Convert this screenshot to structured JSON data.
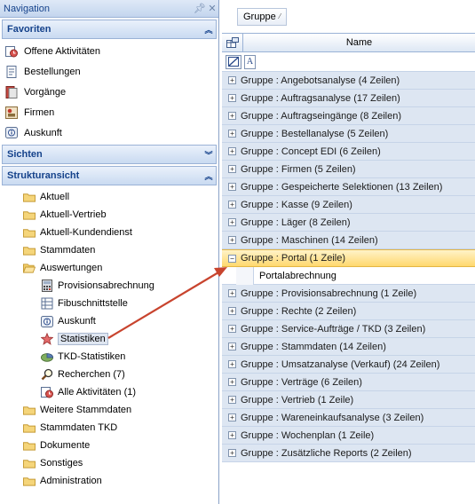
{
  "nav": {
    "title": "Navigation",
    "favorites": {
      "title": "Favoriten",
      "items": [
        {
          "label": "Offene Aktivitäten",
          "icon": "activities-icon"
        },
        {
          "label": "Bestellungen",
          "icon": "orders-icon"
        },
        {
          "label": "Vorgänge",
          "icon": "processes-icon"
        },
        {
          "label": "Firmen",
          "icon": "companies-icon"
        },
        {
          "label": "Auskunft",
          "icon": "info-icon"
        }
      ]
    },
    "views": {
      "title": "Sichten"
    },
    "structure": {
      "title": "Strukturansicht",
      "items": [
        {
          "label": "Aktuell",
          "icon": "folder-icon",
          "level": 1
        },
        {
          "label": "Aktuell-Vertrieb",
          "icon": "folder-icon",
          "level": 1
        },
        {
          "label": "Aktuell-Kundendienst",
          "icon": "folder-icon",
          "level": 1
        },
        {
          "label": "Stammdaten",
          "icon": "folder-icon",
          "level": 1
        },
        {
          "label": "Auswertungen",
          "icon": "folder-open-icon",
          "level": 1
        },
        {
          "label": "Provisionsabrechnung",
          "icon": "calculator-icon",
          "level": 2
        },
        {
          "label": "Fibuschnittstelle",
          "icon": "ledger-icon",
          "level": 2
        },
        {
          "label": "Auskunft",
          "icon": "info-icon",
          "level": 2
        },
        {
          "label": "Statistiken",
          "icon": "star-icon",
          "level": 2,
          "selected": true
        },
        {
          "label": "TKD-Statistiken",
          "icon": "chart-disc-icon",
          "level": 2
        },
        {
          "label": "Recherchen (7)",
          "icon": "magnifier-icon",
          "level": 2
        },
        {
          "label": "Alle Aktivitäten (1)",
          "icon": "activities-icon",
          "level": 2
        },
        {
          "label": "Weitere Stammdaten",
          "icon": "folder-icon",
          "level": 1
        },
        {
          "label": "Stammdaten TKD",
          "icon": "folder-icon",
          "level": 1
        },
        {
          "label": "Dokumente",
          "icon": "folder-icon",
          "level": 1
        },
        {
          "label": "Sonstiges",
          "icon": "folder-icon",
          "level": 1
        },
        {
          "label": "Administration",
          "icon": "folder-icon",
          "level": 1
        }
      ]
    }
  },
  "grid": {
    "group_chip": "Gruppe",
    "column_name": "Name",
    "filter_a": "A",
    "groups": [
      {
        "label": "Gruppe : Angebotsanalyse (4 Zeilen)"
      },
      {
        "label": "Gruppe : Auftragsanalyse (17 Zeilen)"
      },
      {
        "label": "Gruppe : Auftragseingänge (8 Zeilen)"
      },
      {
        "label": "Gruppe : Bestellanalyse (5 Zeilen)"
      },
      {
        "label": "Gruppe : Concept EDI (6 Zeilen)"
      },
      {
        "label": "Gruppe : Firmen (5 Zeilen)"
      },
      {
        "label": "Gruppe : Gespeicherte Selektionen (13 Zeilen)"
      },
      {
        "label": "Gruppe : Kasse (9 Zeilen)"
      },
      {
        "label": "Gruppe : Läger (8 Zeilen)"
      },
      {
        "label": "Gruppe : Maschinen (14 Zeilen)"
      },
      {
        "label": "Gruppe : Portal (1 Zeile)",
        "expanded": true,
        "rows": [
          "Portalabrechnung"
        ]
      },
      {
        "label": "Gruppe : Provisionsabrechnung (1 Zeile)"
      },
      {
        "label": "Gruppe : Rechte (2 Zeilen)"
      },
      {
        "label": "Gruppe : Service-Aufträge / TKD (3 Zeilen)"
      },
      {
        "label": "Gruppe : Stammdaten (14 Zeilen)"
      },
      {
        "label": "Gruppe : Umsatzanalyse (Verkauf) (24 Zeilen)"
      },
      {
        "label": "Gruppe : Verträge (6 Zeilen)"
      },
      {
        "label": "Gruppe : Vertrieb (1 Zeile)"
      },
      {
        "label": "Gruppe : Wareneinkaufsanalyse (3 Zeilen)"
      },
      {
        "label": "Gruppe : Wochenplan (1 Zeile)"
      },
      {
        "label": "Gruppe : Zusätzliche Reports (2 Zeilen)"
      }
    ]
  },
  "colors": {
    "header_text": "#15428b",
    "group_row": "#dde6f2",
    "active_group": "#ffd86e",
    "arrow": "#c8442e"
  }
}
